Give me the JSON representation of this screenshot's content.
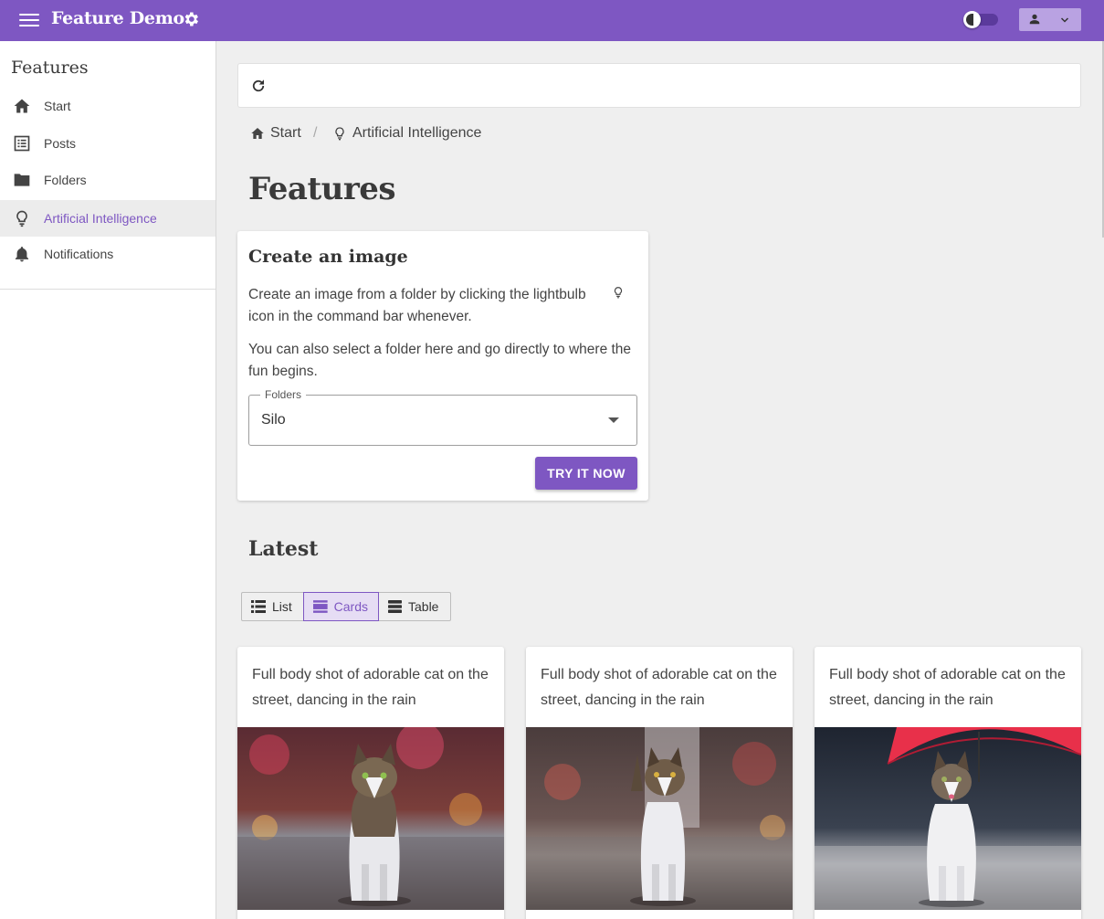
{
  "app": {
    "title": "Feature Demo",
    "accent_color": "#7e57c2",
    "settings_icon": "gear-icon",
    "theme_toggle_icon": "moon-icon",
    "user_menu_icon": "person-icon"
  },
  "sidebar": {
    "heading": "Features",
    "items": [
      {
        "label": "Start",
        "icon": "home-icon",
        "active": false
      },
      {
        "label": "Posts",
        "icon": "list-alt-icon",
        "active": false
      },
      {
        "label": "Folders",
        "icon": "folder-icon",
        "active": false
      },
      {
        "label": "Artificial Intelligence",
        "icon": "lightbulb-icon",
        "active": true
      },
      {
        "label": "Notifications",
        "icon": "bell-icon",
        "active": false
      }
    ]
  },
  "toolbar": {
    "refresh_icon": "refresh-icon"
  },
  "breadcrumb": {
    "items": [
      {
        "label": "Start",
        "icon": "home-icon"
      },
      {
        "label": "Artificial Intelligence",
        "icon": "lightbulb-icon"
      }
    ],
    "separator": "/"
  },
  "page": {
    "title": "Features"
  },
  "create_card": {
    "title": "Create an image",
    "para1": "Create an image from a folder by clicking the lightbulb icon in the command bar whenever.",
    "para2": "You can also select a folder here and go directly to where the fun begins.",
    "select_label": "Folders",
    "select_value": "Silo",
    "button_label": "TRY IT NOW"
  },
  "latest": {
    "heading": "Latest",
    "view_options": [
      {
        "label": "List",
        "icon": "list-icon",
        "active": false
      },
      {
        "label": "Cards",
        "icon": "cards-icon",
        "active": true
      },
      {
        "label": "Table",
        "icon": "table-icon",
        "active": false
      }
    ],
    "cards": [
      {
        "caption": "Full body shot of adorable cat on the street, dancing in the rain"
      },
      {
        "caption": "Full body shot of adorable cat on the street, dancing in the rain"
      },
      {
        "caption": "Full body shot of adorable cat on the street, dancing in the rain"
      }
    ]
  }
}
